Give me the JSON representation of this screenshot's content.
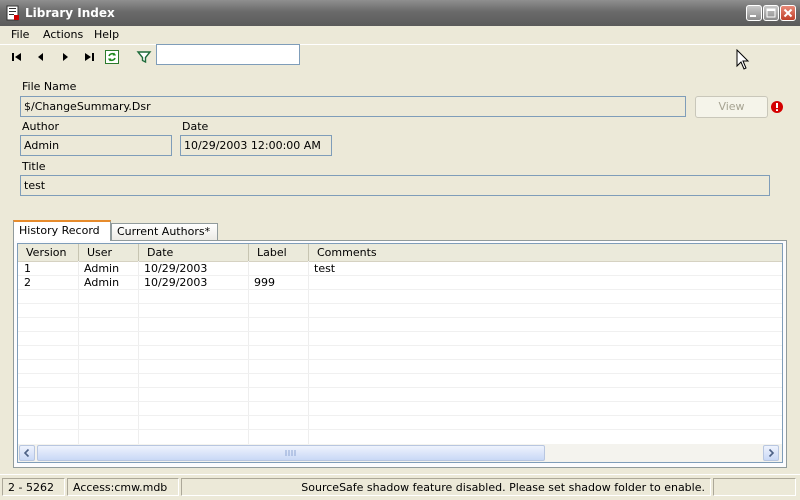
{
  "window": {
    "title": "Library Index"
  },
  "menu": {
    "file": "File",
    "actions": "Actions",
    "help": "Help"
  },
  "toolbar": {
    "filter_value": ""
  },
  "form": {
    "file_name_label": "File Name",
    "file_name_value": "$/ChangeSummary.Dsr",
    "view_button": "View",
    "author_label": "Author",
    "author_value": "Admin",
    "date_label": "Date",
    "date_value": "10/29/2003 12:00:00 AM",
    "title_label": "Title",
    "title_value": "test"
  },
  "tabs": {
    "history": "History Record",
    "authors": "Current Authors*"
  },
  "history": {
    "columns": [
      "Version",
      "User",
      "Date",
      "Label",
      "Comments"
    ],
    "rows": [
      {
        "version": "1",
        "user": "Admin",
        "date": "10/29/2003",
        "label": "",
        "comments": "test"
      },
      {
        "version": "2",
        "user": "Admin",
        "date": "10/29/2003",
        "label": "999",
        "comments": ""
      }
    ]
  },
  "status": {
    "record": "2 - 5262",
    "database": "Access:cmw.mdb",
    "message": "SourceSafe shadow feature disabled.  Please set shadow folder to enable."
  },
  "colors": {
    "title_bar": "#6a6a6a",
    "window_bg": "#ece9d8",
    "field_border": "#7f9db9",
    "active_tab_accent": "#e68b2c",
    "error": "#d40000"
  }
}
